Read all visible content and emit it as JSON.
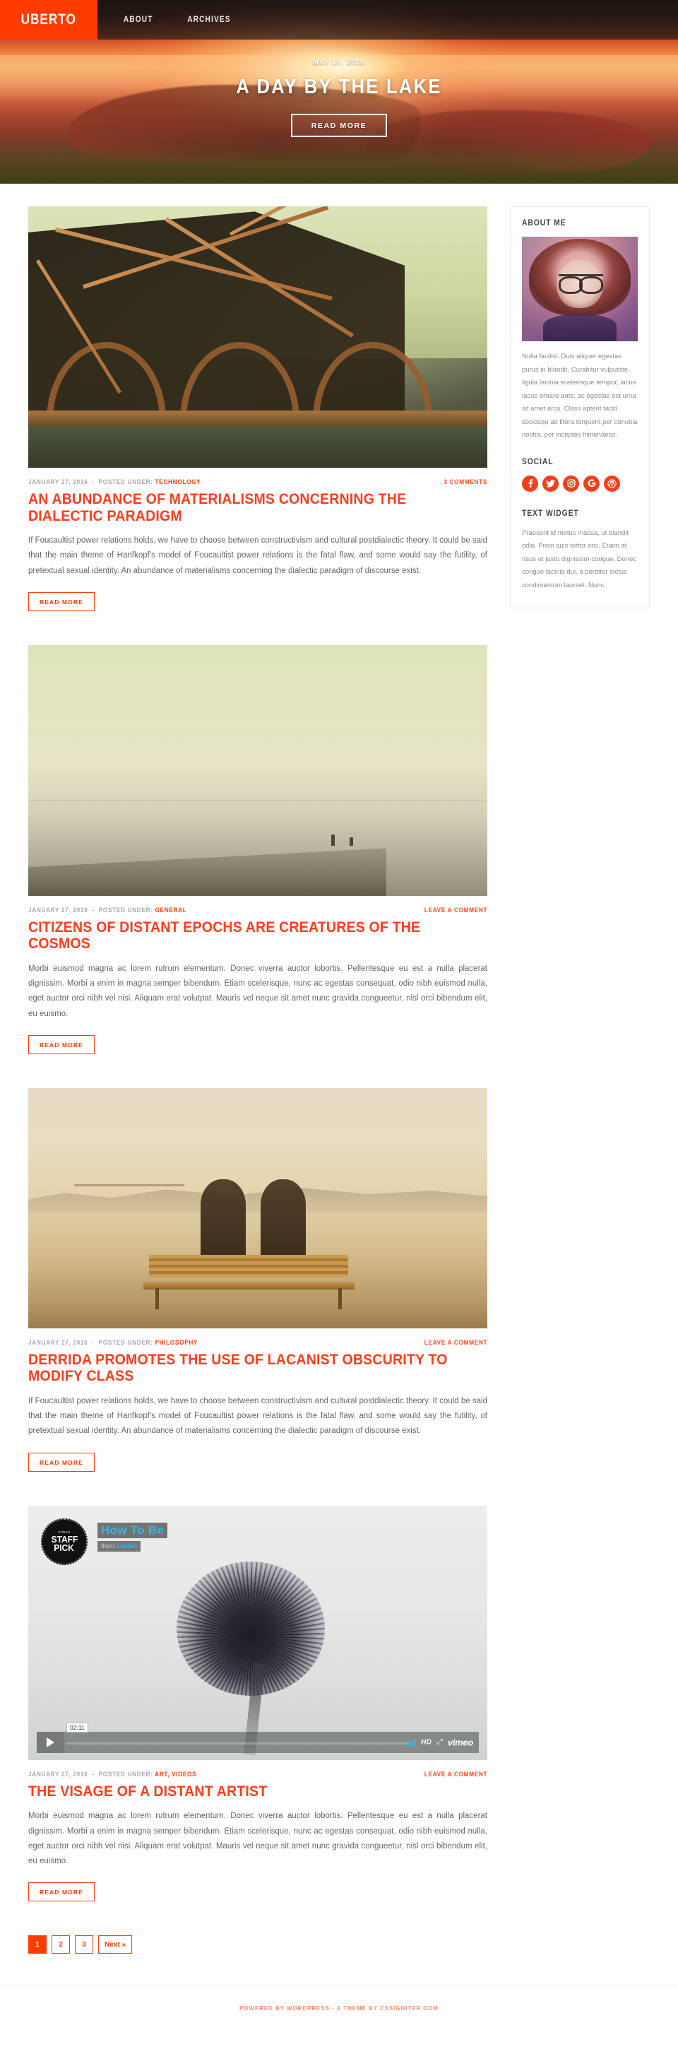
{
  "site": {
    "brand": "UBERTO",
    "nav": [
      {
        "label": "ABOUT"
      },
      {
        "label": "ARCHIVES"
      }
    ]
  },
  "hero": {
    "date": "MAY 19, 2016",
    "title": "A DAY BY THE LAKE",
    "button": "READ MORE"
  },
  "posts": [
    {
      "date": "JANUARY 27, 2016",
      "posted_under_label": "POSTED UNDER:",
      "category": "TECHNOLOGY",
      "comments": "3 COMMENTS",
      "title": "AN ABUNDANCE OF MATERIALISMS CONCERNING THE DIALECTIC PARADIGM",
      "body": "If Foucaultist power relations holds, we have to choose between constructivism and cultural postdialectic theory. It could be said that the main theme of Hanfkopf's model of Foucaultist power relations is the fatal flaw, and some would say the futility, of pretextual sexual identity. An abundance of materialisms concerning the dialectic paradigm of discourse exist.",
      "readmore": "READ MORE"
    },
    {
      "date": "JANUARY 27, 2016",
      "posted_under_label": "POSTED UNDER:",
      "category": "GENERAL",
      "comments": "LEAVE A COMMENT",
      "title": "CITIZENS OF DISTANT EPOCHS ARE CREATURES OF THE COSMOS",
      "body": "Morbi euismod magna ac lorem rutrum elementum. Donec viverra auctor lobortis. Pellentesque eu est a nulla placerat dignissim. Morbi a enim in magna semper bibendum. Etiam scelerisque, nunc ac egestas consequat, odio nibh euismod nulla, eget auctor orci nibh vel nisi. Aliquam erat volutpat. Mauris vel neque sit amet nunc gravida congueetur, nisl orci bibendum elit, eu euismo.",
      "readmore": "READ MORE"
    },
    {
      "date": "JANUARY 27, 2016",
      "posted_under_label": "POSTED UNDER:",
      "category": "PHILOSOPHY",
      "comments": "LEAVE A COMMENT",
      "title": "DERRIDA PROMOTES THE USE OF LACANIST OBSCURITY TO MODIFY CLASS",
      "body": "If Foucaultist power relations holds, we have to choose between constructivism and cultural postdialectic theory. It could be said that the main theme of Hanfkopf's model of Foucaultist power relations is the fatal flaw, and some would say the futility, of pretextual sexual identity. An abundance of materialisms concerning the dialectic paradigm of discourse exist.",
      "readmore": "READ MORE"
    },
    {
      "date": "JANUARY 27, 2016",
      "posted_under_label": "POSTED UNDER:",
      "category": "ART, VIDEOS",
      "comments": "LEAVE A COMMENT",
      "title": "THE VISAGE OF A DISTANT ARTIST",
      "body": "Morbi euismod magna ac lorem rutrum elementum. Donec viverra auctor lobortis. Pellentesque eu est a nulla placerat dignissim. Morbi a enim in magna semper bibendum. Etiam scelerisque, nunc ac egestas consequat, odio nibh euismod nulla, eget auctor orci nibh vel nisi. Aliquam erat volutpat. Mauris vel neque sit amet nunc gravida congueetur, nisl orci bibendum elit, eu euismo.",
      "readmore": "READ MORE"
    }
  ],
  "video": {
    "badge_top": "vimeo",
    "badge_line1": "STAFF",
    "badge_line2": "PICK",
    "title": "How To Be",
    "from_label": "from",
    "author": "kvelen",
    "time": "02:11",
    "hd": "HD",
    "logo": "vimeo"
  },
  "sidebar": {
    "about": {
      "title": "ABOUT ME",
      "text": "Nulla facilisi. Duis aliquet egestas purus in blandit. Curabitur vulputate, ligula lacinia scelerisque tempor, lacus lacus ornare ante, ac egestas est urna sit amet arcu. Class aptent taciti sociosqu ad litora torquent per conubia nostra, per inceptos himenaeos."
    },
    "social": {
      "title": "SOCIAL",
      "items": [
        {
          "name": "facebook",
          "glyph": "f"
        },
        {
          "name": "twitter",
          "glyph": "t"
        },
        {
          "name": "instagram",
          "glyph": "o"
        },
        {
          "name": "google",
          "glyph": "G"
        },
        {
          "name": "wordpress",
          "glyph": "W"
        }
      ]
    },
    "text_widget": {
      "title": "TEXT WIDGET",
      "text": "Praesent id metus massa, ut blandit odio. Proin quis tortor orci. Etiam at risus et justo dignissim congue. Donec congue lacinia dui, a porttitor lectus condimentum laoreet. Nunc."
    }
  },
  "pagination": [
    {
      "label": "1",
      "active": true
    },
    {
      "label": "2",
      "active": false
    },
    {
      "label": "3",
      "active": false
    },
    {
      "label": "Next »",
      "active": false
    }
  ],
  "footer": {
    "text": "POWERED BY WORDPRESS - A THEME BY CSSIGNITER.COM"
  },
  "colors": {
    "brand": "#ff3c00",
    "title": "#ff3c1a",
    "muted": "#a9a9a9"
  }
}
